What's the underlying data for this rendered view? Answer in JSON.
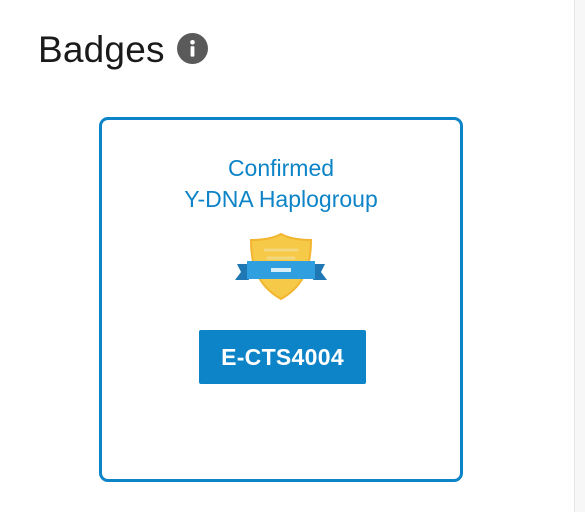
{
  "section": {
    "title": "Badges",
    "info_icon": "info-icon"
  },
  "badge": {
    "title_line1": "Confirmed",
    "title_line2": "Y-DNA Haplogroup",
    "emblem_icon": "shield-ribbon-icon",
    "haplogroup": "E-CTS4004"
  },
  "colors": {
    "accent": "#0d84c7",
    "shield_gold": "#f7c948",
    "ribbon_blue": "#2f9fe0",
    "info_gray": "#5a5a5a"
  }
}
